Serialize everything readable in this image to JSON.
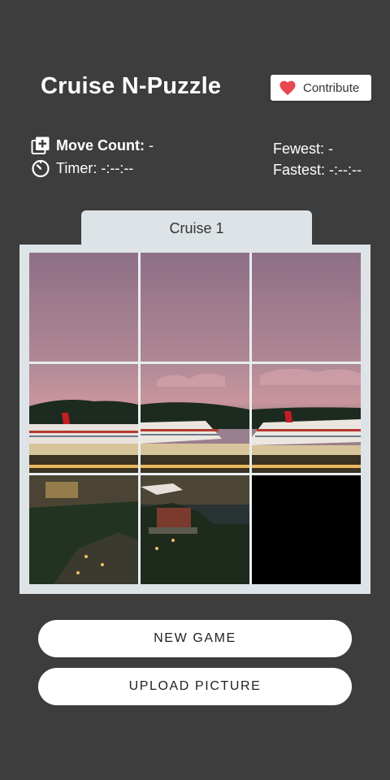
{
  "app": {
    "title": "Cruise N-Puzzle",
    "contribute_label": "Contribute"
  },
  "stats": {
    "move_count_label": "Move Count:",
    "move_count_value": "-",
    "timer_label": "Timer:",
    "timer_value": "-:--:--",
    "fewest_label": "Fewest:",
    "fewest_value": "-",
    "fastest_label": "Fastest:",
    "fastest_value": "-:--:--"
  },
  "puzzle": {
    "tab_label": "Cruise 1",
    "grid": "3x3",
    "empty_tile_position": "bottom-right"
  },
  "buttons": {
    "new_game": "NEW GAME",
    "upload_picture": "UPLOAD PICTURE"
  },
  "colors": {
    "background": "#3d3d3e",
    "heart": "#e8474f",
    "panel": "#dde3e6"
  },
  "icons": {
    "contribute": "heart-icon",
    "move_count": "add-box-icon",
    "timer": "timer-icon"
  }
}
